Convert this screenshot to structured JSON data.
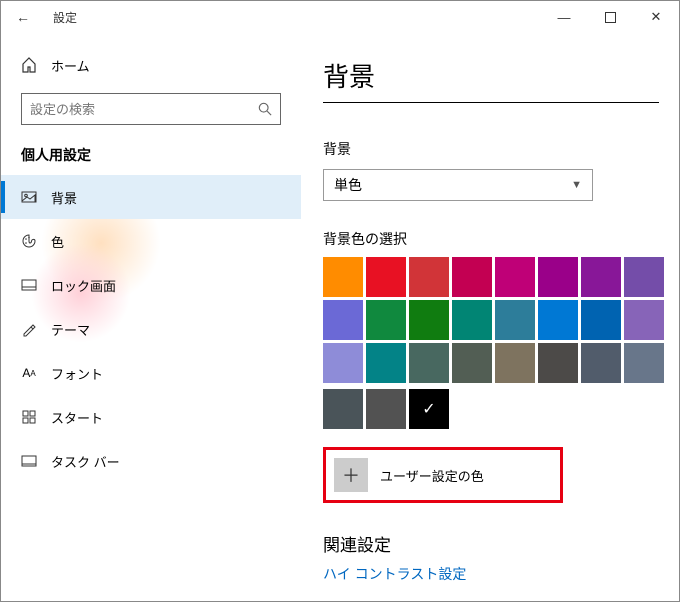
{
  "window": {
    "title": "設定"
  },
  "sidebar": {
    "home_label": "ホーム",
    "search_placeholder": "設定の検索",
    "section_title": "個人用設定",
    "items": [
      {
        "label": "背景"
      },
      {
        "label": "色"
      },
      {
        "label": "ロック画面"
      },
      {
        "label": "テーマ"
      },
      {
        "label": "フォント"
      },
      {
        "label": "スタート"
      },
      {
        "label": "タスク バー"
      }
    ]
  },
  "content": {
    "page_title": "背景",
    "bg_label": "背景",
    "bg_value": "単色",
    "swatch_label": "背景色の選択",
    "colors": {
      "row1": [
        "#ff8c00",
        "#e81123",
        "#d13438",
        "#c30052",
        "#bf0077",
        "#9a0089",
        "#881798",
        "#744da9"
      ],
      "row2": [
        "#6b69d6",
        "#10893e",
        "#107c10",
        "#018574",
        "#2d7d9a",
        "#0078d4",
        "#0063b1",
        "#8764b8"
      ],
      "row3": [
        "#8e8cd8",
        "#038387",
        "#486860",
        "#525e54",
        "#7e735f",
        "#4c4a48",
        "#515c6b",
        "#68768a"
      ],
      "row4": [
        "#4a5459",
        "#525252",
        "#000000"
      ]
    },
    "selected_index": "row4.2",
    "custom_color_label": "ユーザー設定の色",
    "related_title": "関連設定",
    "related_link": "ハイ コントラスト設定"
  }
}
